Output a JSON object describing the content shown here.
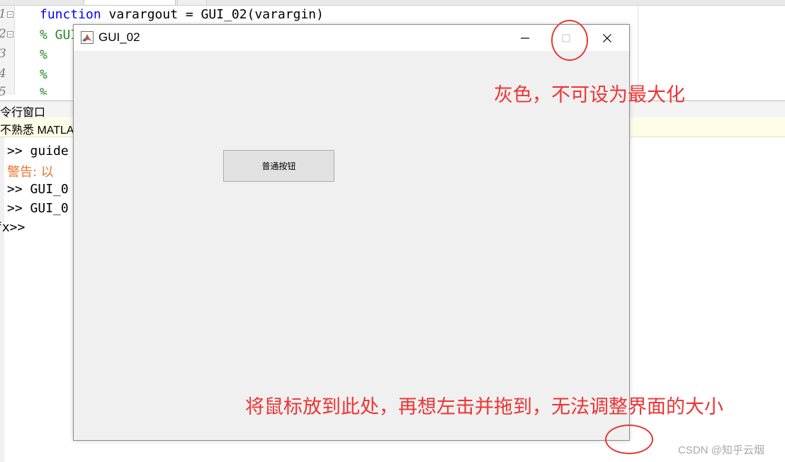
{
  "editor": {
    "line_numbers": [
      "1",
      "2",
      "3",
      "4",
      "5"
    ],
    "lines": [
      {
        "keyword": "function",
        "rest": " varargout = GUI_02(varargin)"
      },
      {
        "comment": "% GUI"
      },
      {
        "comment": "%"
      },
      {
        "comment": "%"
      },
      {
        "comment": "%"
      }
    ]
  },
  "command_window": {
    "title": "令行窗口",
    "banner": "不熟悉 MATLA",
    "lines": [
      {
        "prompt": ">>",
        "text": " guide"
      },
      {
        "warning": "警告: 以"
      },
      {
        "prompt": ">>",
        "text": " GUI_0"
      },
      {
        "prompt": ">>",
        "text": " GUI_0"
      },
      {
        "prompt": "fx>>",
        "text": ""
      }
    ]
  },
  "gui_window": {
    "title": "GUI_02",
    "button_label": "普通按钮"
  },
  "annotations": {
    "maximize_note": "灰色，不可设为最大化",
    "resize_note": "将鼠标放到此处，再想左击并拖到，无法调整界面的大小"
  },
  "watermark": "CSDN @知乎云烟",
  "colors": {
    "annotation": "#ee3333",
    "keyword": "#0000ff",
    "comment": "#228b22",
    "warning": "#e8742c"
  }
}
